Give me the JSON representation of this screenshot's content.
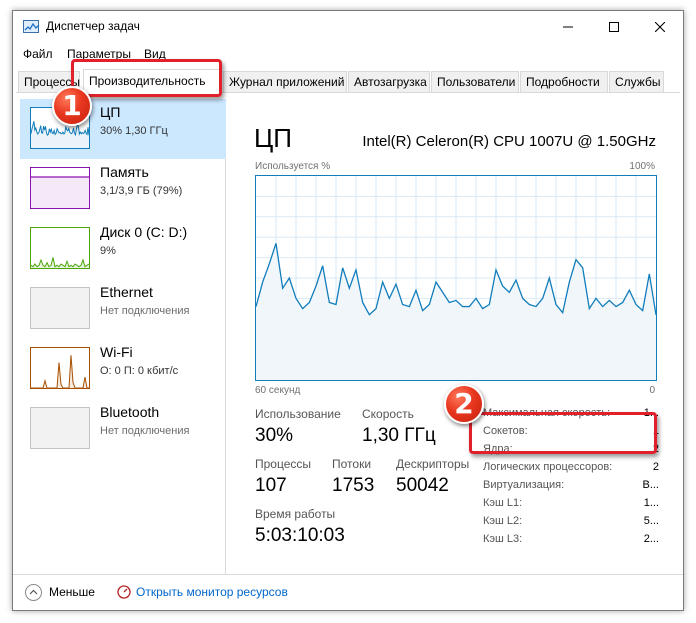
{
  "window": {
    "title": "Диспетчер задач"
  },
  "menu": [
    "Файл",
    "Параметры",
    "Вид"
  ],
  "tabs": [
    {
      "label": "Процессы"
    },
    {
      "label": "Производительность"
    },
    {
      "label": "Журнал приложений"
    },
    {
      "label": "Автозагрузка"
    },
    {
      "label": "Пользователи"
    },
    {
      "label": "Подробности"
    },
    {
      "label": "Службы"
    }
  ],
  "sidebar": [
    {
      "name": "ЦП",
      "sub": "30%  1,30 ГГц",
      "color": "#117dbb"
    },
    {
      "name": "Память",
      "sub": "3,1/3,9 ГБ (79%)",
      "color": "#8b12ae"
    },
    {
      "name": "Диск 0 (C: D:)",
      "sub": "9%",
      "color": "#4da60c"
    },
    {
      "name": "Ethernet",
      "sub": "Нет подключения",
      "color": "#c4c4c4"
    },
    {
      "name": "Wi-Fi",
      "sub": "О: 0  П: 0 кбит/с",
      "color": "#a74f01"
    },
    {
      "name": "Bluetooth",
      "sub": "Нет подключения",
      "color": "#c4c4c4"
    }
  ],
  "main": {
    "title": "ЦП",
    "cpu_model": "Intel(R) Celeron(R) CPU 1007U @ 1.50GHz",
    "graph_top_left": "Используется %",
    "graph_top_right": "100%",
    "graph_bottom_left": "60 секунд",
    "graph_bottom_right": "0"
  },
  "chart_data": {
    "type": "area",
    "ylim": [
      0,
      100
    ],
    "x": [
      60,
      59,
      58,
      57,
      56,
      55,
      54,
      53,
      52,
      51,
      50,
      49,
      48,
      47,
      46,
      45,
      44,
      43,
      42,
      41,
      40,
      39,
      38,
      37,
      36,
      35,
      34,
      33,
      32,
      31,
      30,
      29,
      28,
      27,
      26,
      25,
      24,
      23,
      22,
      21,
      20,
      19,
      18,
      17,
      16,
      15,
      14,
      13,
      12,
      11,
      10,
      9,
      8,
      7,
      6,
      5,
      4,
      3,
      2,
      1,
      0
    ],
    "values": [
      36,
      48,
      57,
      67,
      45,
      50,
      40,
      35,
      38,
      46,
      56,
      38,
      37,
      55,
      45,
      54,
      38,
      32,
      35,
      48,
      40,
      47,
      37,
      36,
      44,
      34,
      37,
      48,
      43,
      38,
      39,
      36,
      36,
      40,
      35,
      37,
      54,
      46,
      43,
      49,
      40,
      37,
      36,
      40,
      50,
      37,
      33,
      48,
      59,
      55,
      35,
      40,
      36,
      39,
      36,
      38,
      44,
      37,
      34,
      52,
      32
    ]
  },
  "stats": {
    "usage_label": "Использование",
    "usage_value": "30%",
    "speed_label": "Скорость",
    "speed_value": "1,30 ГГц",
    "processes_label": "Процессы",
    "processes_value": "107",
    "threads_label": "Потоки",
    "threads_value": "1753",
    "handles_label": "Дескрипторы",
    "handles_value": "50042",
    "uptime_label": "Время работы",
    "uptime_value": "5:03:10:03"
  },
  "specs": [
    {
      "label": "Максимальная скорость:",
      "value": "1..."
    },
    {
      "label": "Сокетов:",
      "value": "1"
    },
    {
      "label": "Ядра:",
      "value": "2"
    },
    {
      "label": "Логических процессоров:",
      "value": "2"
    },
    {
      "label": "Виртуализация:",
      "value": "В..."
    },
    {
      "label": "Кэш L1:",
      "value": "1..."
    },
    {
      "label": "Кэш L2:",
      "value": "5..."
    },
    {
      "label": "Кэш L3:",
      "value": "2..."
    }
  ],
  "footer": {
    "fewer": "Меньше",
    "resmon": "Открыть монитор ресурсов"
  },
  "callouts": {
    "one": "1",
    "two": "2"
  }
}
